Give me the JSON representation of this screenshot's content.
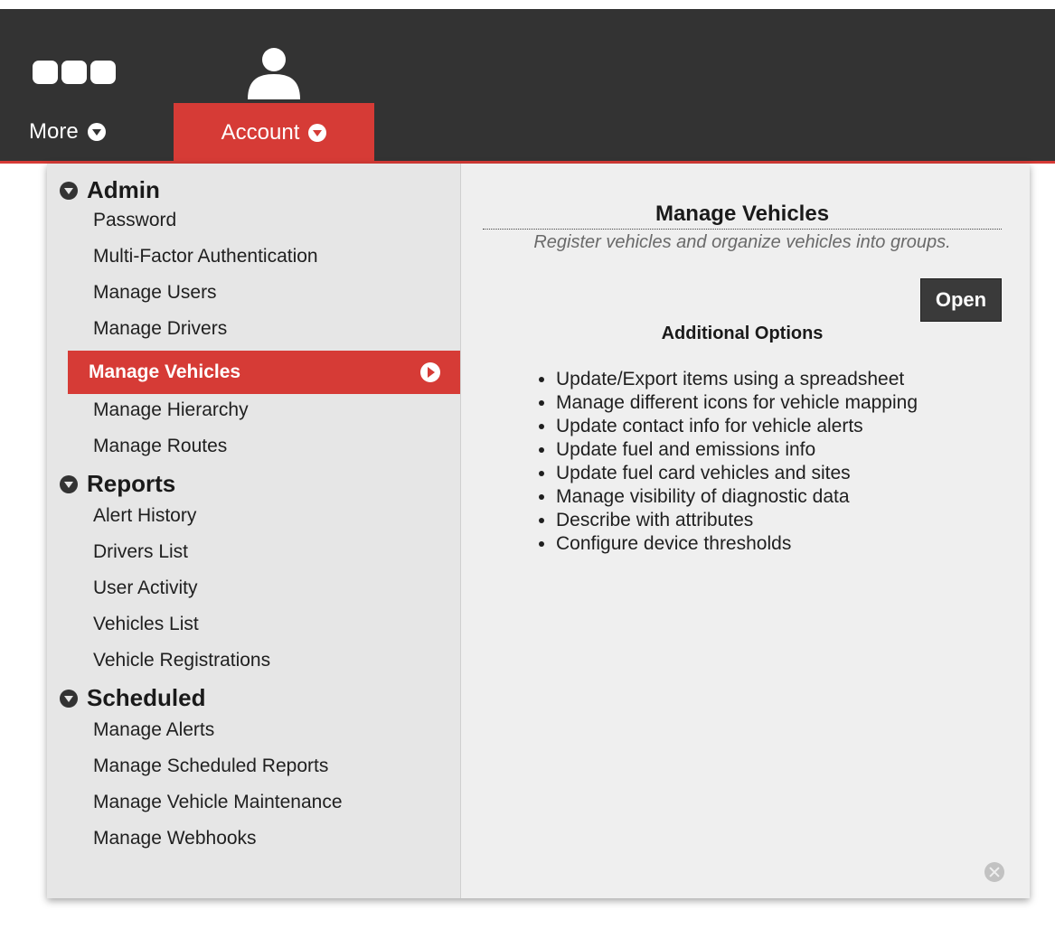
{
  "header": {
    "apps_icon": "three-dots-apps-icon",
    "user_icon": "user-silhouette-icon",
    "tabs": [
      {
        "label": "More",
        "icon": "chevron-down-circle-icon"
      },
      {
        "label": "Account",
        "icon": "chevron-down-circle-icon",
        "active": true
      }
    ],
    "accent_color": "#d63b36",
    "bar_color": "#333333"
  },
  "menu": {
    "sections": [
      {
        "title": "Admin",
        "items": [
          "Password",
          "Multi-Factor Authentication",
          "Manage Users",
          "Manage Drivers",
          "Manage Vehicles",
          "Manage Hierarchy",
          "Manage Routes"
        ]
      },
      {
        "title": "Reports",
        "items": [
          "Alert History",
          "Drivers List",
          "User Activity",
          "Vehicles List",
          "Vehicle Registrations"
        ]
      },
      {
        "title": "Scheduled",
        "items": [
          "Manage Alerts",
          "Manage Scheduled Reports",
          "Manage Vehicle Maintenance",
          "Manage Webhooks"
        ]
      }
    ],
    "active_item": "Manage Vehicles"
  },
  "detail": {
    "title": "Manage Vehicles",
    "subtitle": "Register vehicles and organize vehicles into groups.",
    "open_label": "Open",
    "additional_heading": "Additional Options",
    "options": [
      "Update/Export items using a spreadsheet",
      "Manage different icons for vehicle mapping",
      "Update contact info for vehicle alerts",
      "Update fuel and emissions info",
      "Update fuel card vehicles and sites",
      "Manage visibility of diagnostic data",
      "Describe with attributes",
      "Configure device thresholds"
    ]
  }
}
